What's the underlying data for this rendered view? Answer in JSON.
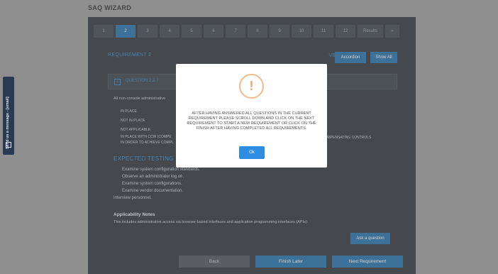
{
  "wizard": {
    "title": "SAQ WIZARD"
  },
  "steps": [
    "1",
    "2",
    "3",
    "4",
    "5",
    "6",
    "7",
    "8",
    "9",
    "10",
    "11",
    "12",
    "Results",
    "»"
  ],
  "requirement": {
    "title": "REQUIREMENT 2",
    "views_label": "VIEWS",
    "accordion_label": "Accordion",
    "show_all_label": "Show All",
    "question_label": "QUESTION 2.2.7",
    "question_text": "All non-console administrative",
    "options": [
      "IN PLACE",
      "NOT IN PLACE",
      "NOT APPLICABLE",
      "IN PLACE WITH CCW (COMPE",
      "IN ORDER TO ACHIEVE COMPL"
    ],
    "options_right": "COMPENSATING CONTROLS"
  },
  "expected_testing": {
    "title": "EXPECTED TESTING",
    "items": [
      "Examine system configuration standards.",
      "Observe an administrator log on.",
      "Examine system configurations.",
      "Examine vendor documentation.",
      "Interview personnel."
    ]
  },
  "applicability": {
    "title": "Applicability Notes",
    "text": "This includes administrative access via browser-based interfaces and application programming interfaces (APIs)."
  },
  "buttons": {
    "ask": "Ask a question",
    "back": "Back",
    "finish_later": "Finish Later",
    "next_requirement": "Next Requirement"
  },
  "side_tab": {
    "label": "Send us a message - [email]"
  },
  "modal": {
    "icon": "!",
    "message": "AFTER HAVING ANSWERED ALL QUESTIONS IN THE CURRENT REQUIREMENT PLEASE SCROLL DOWN AND CLICK ON THE NEXT REQUIREMENT TO START A NEW REQUIREMENT OR CLICK ON THE FINISH AFTER HAVING COMPLETED ALL REQUIREMENTS.",
    "ok_label": "Ok"
  }
}
